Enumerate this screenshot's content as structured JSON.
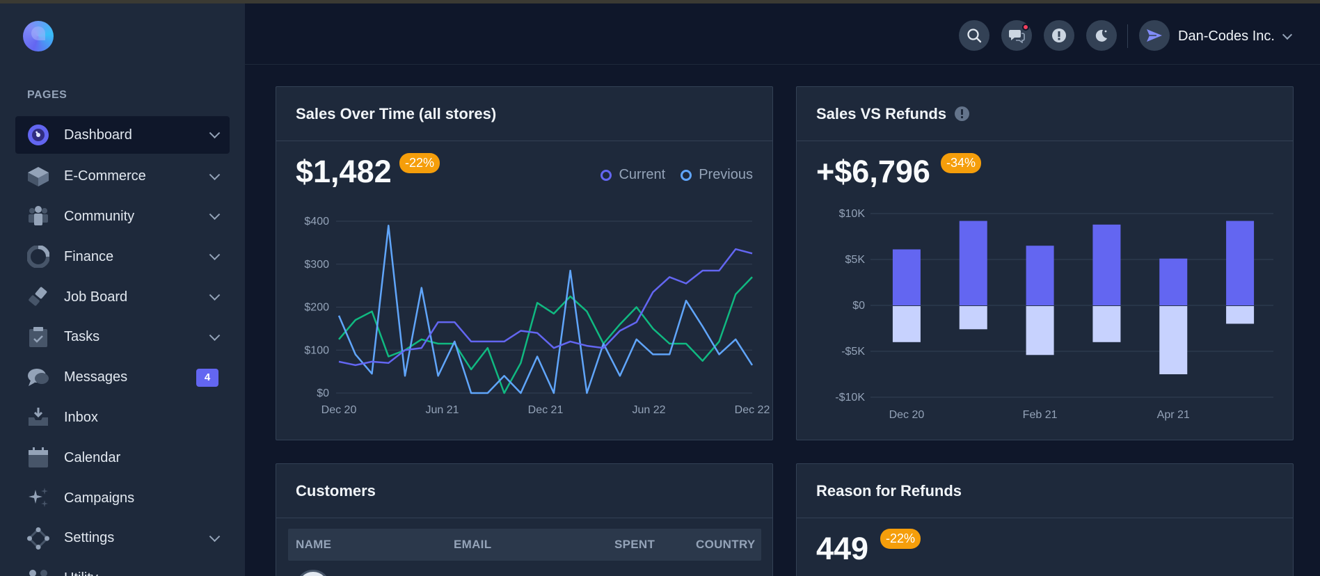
{
  "sidebar": {
    "section_title": "PAGES",
    "items": [
      {
        "label": "Dashboard",
        "icon": "dashboard-icon",
        "active": true,
        "has_chevron": true
      },
      {
        "label": "E-Commerce",
        "icon": "ecommerce-icon",
        "has_chevron": true
      },
      {
        "label": "Community",
        "icon": "community-icon",
        "has_chevron": true
      },
      {
        "label": "Finance",
        "icon": "finance-icon",
        "has_chevron": true
      },
      {
        "label": "Job Board",
        "icon": "job-board-icon",
        "has_chevron": true
      },
      {
        "label": "Tasks",
        "icon": "tasks-icon",
        "has_chevron": true
      },
      {
        "label": "Messages",
        "icon": "messages-icon",
        "badge": "4"
      },
      {
        "label": "Inbox",
        "icon": "inbox-icon"
      },
      {
        "label": "Calendar",
        "icon": "calendar-icon"
      },
      {
        "label": "Campaigns",
        "icon": "campaigns-icon"
      },
      {
        "label": "Settings",
        "icon": "settings-icon",
        "has_chevron": true
      },
      {
        "label": "Utility",
        "icon": "utility-icon"
      }
    ]
  },
  "header": {
    "buttons": [
      "search-icon",
      "chat-icon",
      "info-icon",
      "moon-icon"
    ],
    "user_name": "Dan-Codes Inc."
  },
  "colors": {
    "accent": "#6366f1",
    "current": "#6366f1",
    "previous": "#60a5fa",
    "green": "#10b981",
    "refund": "#c7d2fe",
    "badge": "#f59e0b"
  },
  "cards": {
    "sales_over_time": {
      "title": "Sales Over Time (all stores)",
      "value": "$1,482",
      "change": "-22%",
      "legend": [
        "Current",
        "Previous"
      ]
    },
    "sales_vs_refunds": {
      "title": "Sales VS Refunds",
      "value": "+$6,796",
      "change": "-34%"
    },
    "customers": {
      "title": "Customers",
      "columns": [
        "NAME",
        "EMAIL",
        "SPENT",
        "COUNTRY"
      ]
    },
    "refund_reasons": {
      "title": "Reason for Refunds",
      "value": "449",
      "change": "-22%"
    }
  },
  "chart_data": [
    {
      "type": "line",
      "x_tick_labels": [
        "Dec 20",
        "Jun 21",
        "Dec 21",
        "Jun 22",
        "Dec 22"
      ],
      "y_tick_labels": [
        "$0",
        "$100",
        "$200",
        "$300",
        "$400"
      ],
      "ylim": [
        0,
        400
      ],
      "grid": true,
      "series": [
        {
          "name": "Current",
          "color": "#6366f1",
          "values": [
            73,
            65,
            73,
            70,
            100,
            105,
            165,
            165,
            120,
            120,
            120,
            145,
            140,
            105,
            120,
            110,
            105,
            145,
            165,
            235,
            270,
            255,
            285,
            285,
            335,
            325
          ]
        },
        {
          "name": "Previous",
          "color": "#60a5fa",
          "values": [
            180,
            90,
            45,
            390,
            40,
            245,
            40,
            120,
            0,
            0,
            40,
            0,
            85,
            0,
            285,
            0,
            115,
            40,
            125,
            90,
            90,
            215,
            155,
            90,
            125,
            65
          ]
        },
        {
          "name": "",
          "color": "#10b981",
          "values": [
            125,
            170,
            190,
            85,
            100,
            125,
            115,
            115,
            55,
            105,
            0,
            70,
            210,
            185,
            225,
            190,
            115,
            160,
            200,
            150,
            115,
            115,
            75,
            120,
            230,
            270
          ]
        }
      ]
    },
    {
      "type": "bar",
      "x_tick_labels": [
        "Dec 20",
        "Feb 21",
        "Apr 21"
      ],
      "y_tick_labels": [
        "-$10K",
        "-$5K",
        "$0",
        "$5K",
        "$10K"
      ],
      "ylim": [
        -10000,
        10000
      ],
      "grid": true,
      "series": [
        {
          "name": "",
          "color": "#6366f1",
          "values": [
            6100,
            9200,
            6500,
            8800,
            5100,
            9200
          ]
        },
        {
          "name": "",
          "color": "#c7d2fe",
          "values": [
            -4000,
            -2600,
            -5400,
            -4000,
            -7500,
            -2000
          ]
        }
      ]
    }
  ]
}
